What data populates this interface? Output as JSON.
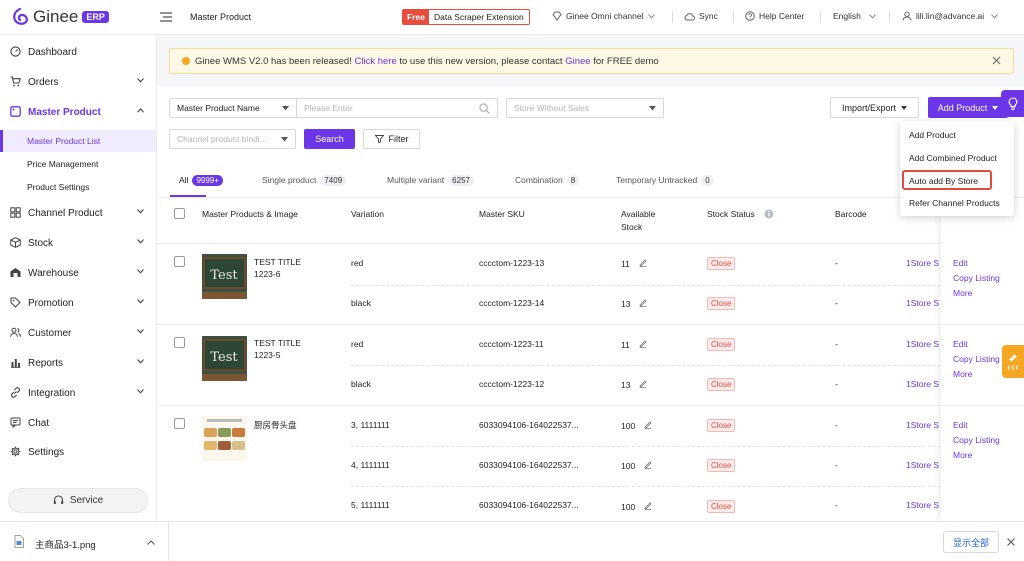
{
  "brand": {
    "name": "Ginee",
    "badge": "ERP"
  },
  "header": {
    "breadcrumb": "Master Product",
    "scraper_free": "Free",
    "scraper_label": "Data Scraper Extension",
    "omni_channel": "Ginee Omni channel",
    "sync": "Sync",
    "help": "Help Center",
    "language": "English",
    "user": "lili.lin@advance.ai"
  },
  "sidebar": {
    "items": [
      {
        "label": "Dashboard",
        "icon": "dashboard-icon"
      },
      {
        "label": "Orders",
        "icon": "cart-icon"
      },
      {
        "label": "Master Product",
        "icon": "tag-icon"
      },
      {
        "label": "Channel Product",
        "icon": "channel-icon"
      },
      {
        "label": "Stock",
        "icon": "box-icon"
      },
      {
        "label": "Warehouse",
        "icon": "warehouse-icon"
      },
      {
        "label": "Promotion",
        "icon": "promotion-icon"
      },
      {
        "label": "Customer",
        "icon": "customer-icon"
      },
      {
        "label": "Reports",
        "icon": "reports-icon"
      },
      {
        "label": "Integration",
        "icon": "integration-icon"
      },
      {
        "label": "Chat",
        "icon": "chat-icon"
      },
      {
        "label": "Settings",
        "icon": "settings-icon"
      }
    ],
    "sub_items": [
      {
        "label": "Master Product List"
      },
      {
        "label": "Price Management"
      },
      {
        "label": "Product Settings"
      }
    ],
    "service": "Service"
  },
  "banner": {
    "text1": "Ginee WMS V2.0 has been released!",
    "link1": "Click here",
    "text2": "to use this new version, please contact",
    "link2": "Ginee",
    "text3": "for FREE demo"
  },
  "filters": {
    "search_type": "Master Product Name",
    "search_placeholder": "Please Enter",
    "store_placeholder": "Store Without Sales",
    "channel_placeholder": "Channel product bindi...",
    "search_button": "Search",
    "filter_button": "Filter",
    "import_export": "Import/Export",
    "add_product": "Add Product"
  },
  "dropdown": {
    "items": [
      "Add Product",
      "Add Combined Product",
      "Auto add By Store",
      "Refer Channel Products"
    ]
  },
  "tabs": [
    {
      "label": "All",
      "count": "9999+"
    },
    {
      "label": "Single product",
      "count": "7409"
    },
    {
      "label": "Multiple variant",
      "count": "6257"
    },
    {
      "label": "Combination",
      "count": "8"
    },
    {
      "label": "Temporary Untracked",
      "count": "0"
    }
  ],
  "table": {
    "headers": {
      "product": "Master Products & Image",
      "variation": "Variation",
      "sku": "Master SKU",
      "stock_line1": "Available",
      "stock_line2": "Stock",
      "status": "Stock Status",
      "barcode": "Barcode"
    },
    "products": [
      {
        "title_line1": "TEST TITLE",
        "title_line2": "1223-6",
        "rows": [
          {
            "variation": "red",
            "sku": "cccctom-1223-13",
            "stock": "11",
            "status": "Close",
            "barcode": "-",
            "store": "1Store S"
          },
          {
            "variation": "black",
            "sku": "cccctom-1223-14",
            "stock": "13",
            "status": "Close",
            "barcode": "-",
            "store": "1Store S"
          }
        ],
        "actions": [
          "Edit",
          "Copy Listing",
          "More"
        ]
      },
      {
        "title_line1": "TEST TITLE",
        "title_line2": "1223-5",
        "rows": [
          {
            "variation": "red",
            "sku": "cccctom-1223-11",
            "stock": "11",
            "status": "Close",
            "barcode": "-",
            "store": "1Store S"
          },
          {
            "variation": "black",
            "sku": "cccctom-1223-12",
            "stock": "13",
            "status": "Close",
            "barcode": "-",
            "store": "1Store S"
          }
        ],
        "actions": [
          "Edit",
          "Copy Listing",
          "More"
        ]
      },
      {
        "title_line1": "厨房骨头盘",
        "title_line2": "",
        "rows": [
          {
            "variation": "3, 1111111",
            "sku": "6033094106-164022537...",
            "stock": "100",
            "status": "Close",
            "barcode": "-",
            "store": "1Store S"
          },
          {
            "variation": "4, 1111111",
            "sku": "6033094106-164022537...",
            "stock": "100",
            "status": "Close",
            "barcode": "-",
            "store": "1Store S"
          },
          {
            "variation": "5, 1111111",
            "sku": "6033094106-164022537...",
            "stock": "100",
            "status": "Close",
            "barcode": "-",
            "store": "1Store S"
          }
        ],
        "actions": [
          "Edit",
          "Copy Listing",
          "More"
        ]
      }
    ],
    "thumb_text": "Test"
  },
  "download_bar": {
    "filename": "主商品3-1.png",
    "show_all": "显示全部"
  },
  "colors": {
    "accent": "#6b35e8",
    "danger": "#e84c3d",
    "warning": "#f5a623"
  }
}
